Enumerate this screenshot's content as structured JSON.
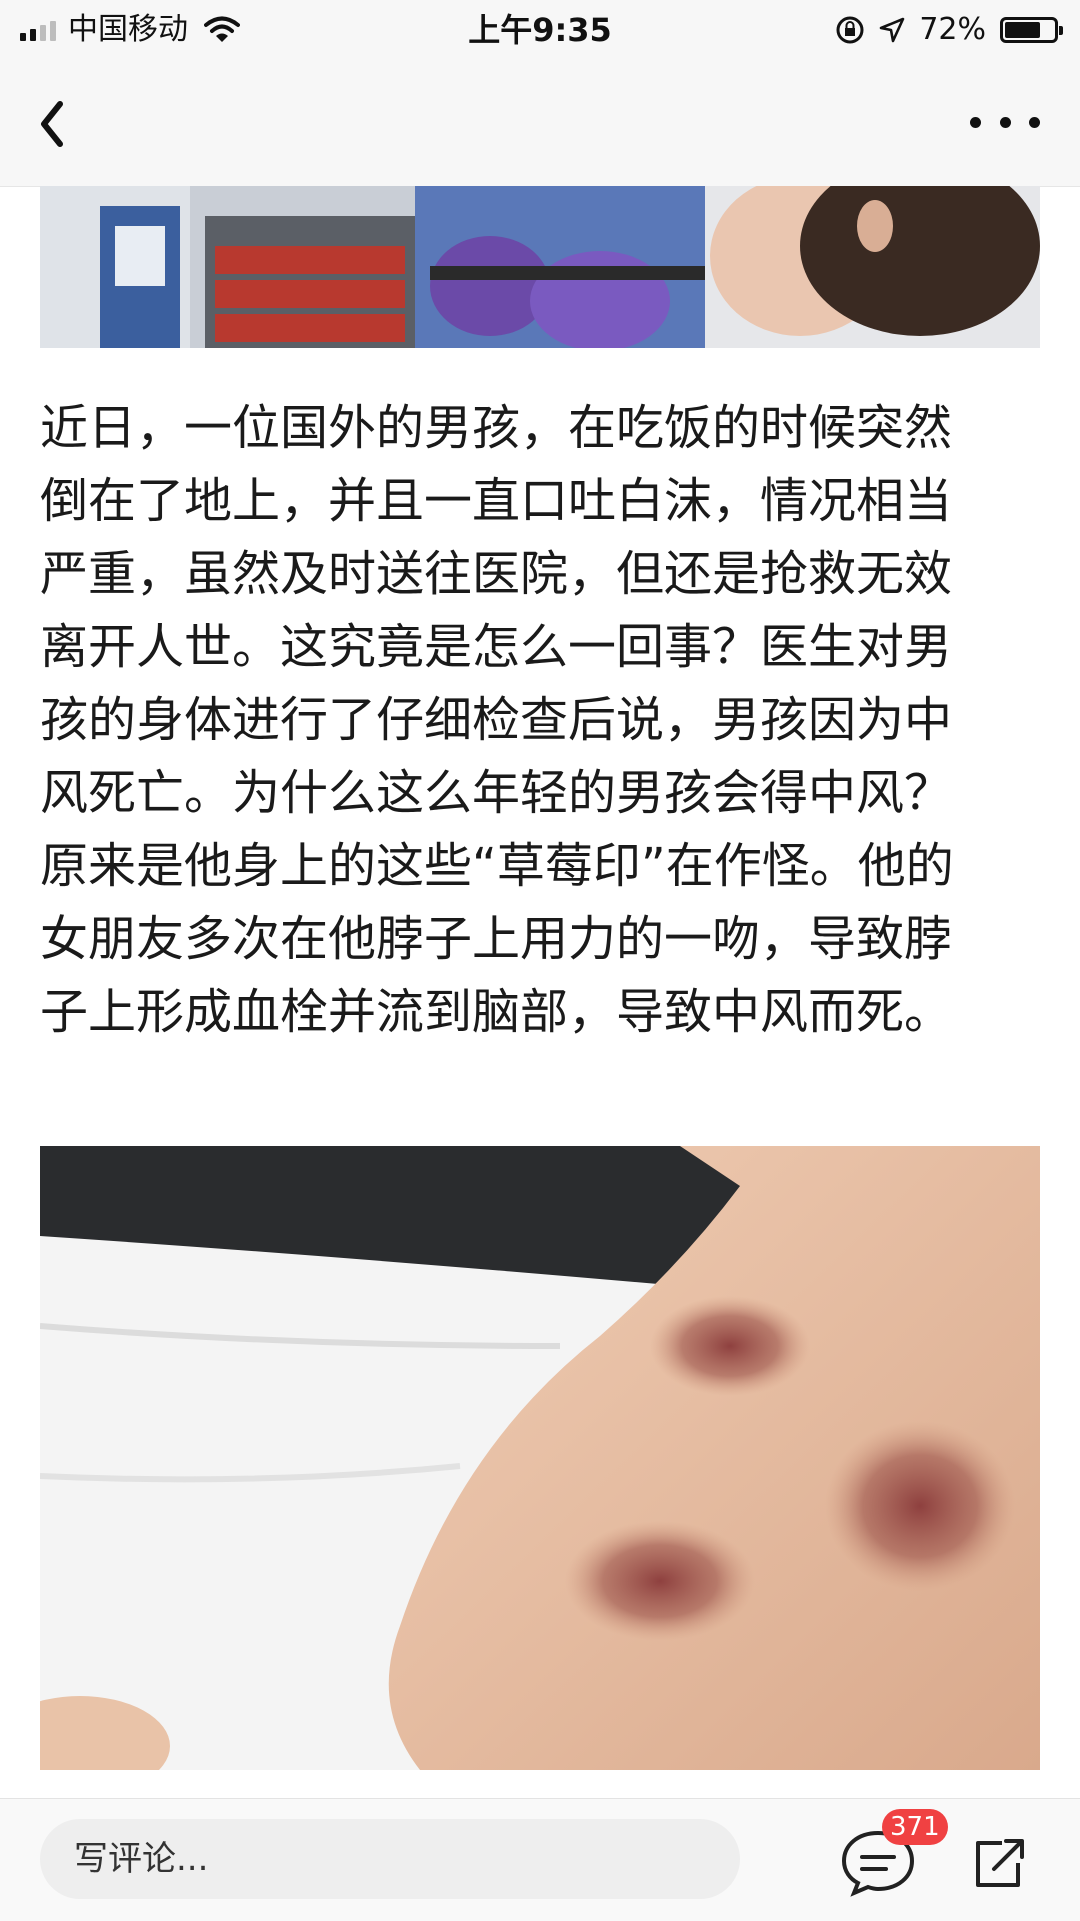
{
  "status_bar": {
    "carrier": "中国移动",
    "time": "上午9:35",
    "battery_percent": "72%",
    "battery_level": 0.72
  },
  "nav": {
    "back_icon": "chevron-left-icon",
    "more_icon": "more-dots-icon"
  },
  "article": {
    "paragraph_lines": [
      "近日，一位国外的男孩，在吃饭的时候突然",
      "倒在了地上，并且一直口吐白沫，情况相当",
      "严重，虽然及时送往医院，但还是抢救无效",
      "离开人世。这究竟是怎么一回事？医生对男",
      "孩的身体进行了仔细检查后说，男孩因为中",
      "风死亡。为什么这么年轻的男孩会得中风？",
      "原来是他身上的这些“草莓印”在作怪。他的",
      "女朋友多次在他脖子上用力的一吻，导致脖",
      "子上形成血栓并流到脑部，导致中风而死。"
    ]
  },
  "bottom_bar": {
    "comment_placeholder": "写评论...",
    "comment_count": "371",
    "comment_icon": "comment-bubble-icon",
    "share_icon": "share-icon",
    "badge_color": "#f04142"
  }
}
